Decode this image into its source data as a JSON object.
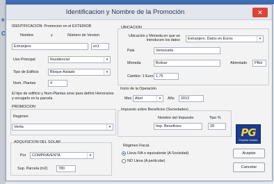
{
  "window": {
    "title": "Identificacion y Nombre de la Promoción",
    "close": "✕"
  },
  "identification": {
    "title": "IDENTIFICACION: Promocion en el EXTERIOR",
    "nombre_label": "Nombre",
    "y_label": "y",
    "numero_version_label": "Número de Version",
    "nombre_value": "Extranjero",
    "version_value": "ex1",
    "uso_label": "Uso Principal",
    "uso_value": "Residencial",
    "tipo_label": "Tipo de Edificio",
    "tipo_value": "Bloque Aislado",
    "plantas_label": "Num. Plantas",
    "plantas_value": "4",
    "note": "El tipo de edificio y Num.Plantas sirve para definir Honorarios y encajarlo en la parcela"
  },
  "ubicacion": {
    "title": "UBICACION",
    "ubicacion_label": "Ubicación y Moneda en que se introducen los datos",
    "ubicacion_value": "Extranjero. Datos en Euros",
    "pais_label": "Pais",
    "pais_value": "Venezuela",
    "moneda_label": "Moneda",
    "moneda_value": "Bolivar",
    "abreviado_label": "Abreviado",
    "abreviado_value": "PBol",
    "cambio_label": "Cambio: 1 Euro",
    "cambio_value": "1.75"
  },
  "inicio": {
    "title": "Inicio de la Operación",
    "mes_label": "Mes",
    "mes_value": "Abril",
    "anio_label": "Año",
    "anio_value": "2013"
  },
  "impuesto": {
    "title": "Impuesto sobre Beneficios (Sociedades)",
    "nombre_label": "Nombre del Impuesto",
    "tipo_label": "Tipo %",
    "nombre_value": "Imp. Beneficios",
    "tipo_value": "28"
  },
  "promocion": {
    "title": "PROMOCION",
    "regimen_label": "Regimen",
    "regimen_value": "Venta"
  },
  "solar": {
    "title": "ADQUISICION DEL SOLAR",
    "por_label": "Por",
    "por_value": "COMPRAVENTA",
    "sup_label": "Sup. Parcela (m2)",
    "sup_value": "780"
  },
  "fiscal": {
    "title": "Régimen Fiscal.",
    "opt1": "Lleva IVA o equivalente (A Sociedad)",
    "opt2": "NO Lleva (A particular)"
  },
  "buttons": {
    "accept": "Aceptar",
    "cancel": "Cancelar"
  },
  "logo": {
    "text": "PG",
    "sub": "Proyecto Gestion"
  },
  "background": {
    "mark1": "e",
    "mark2": "C"
  },
  "colors": {
    "accent": "#1f57a6",
    "close": "#d9453a",
    "logo_bg": "#1d3b8e",
    "logo_text": "#f7d33c"
  },
  "icons": {
    "dropdown": "chevron-down-icon",
    "close": "close-icon"
  }
}
